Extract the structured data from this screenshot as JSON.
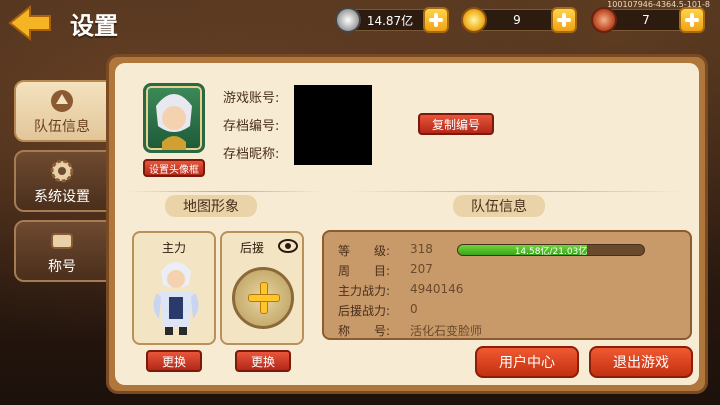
{
  "header": {
    "title": "设置",
    "watermark": "100107946-4364.5-101-8"
  },
  "resources": [
    {
      "name": "silver",
      "icon": "silver-coin-icon",
      "value": "14.87亿"
    },
    {
      "name": "gold",
      "icon": "gold-ingot-icon",
      "value": "9"
    },
    {
      "name": "meat",
      "icon": "meat-icon",
      "value": "7"
    }
  ],
  "tabs": [
    {
      "label": "队伍信息",
      "icon": "team-icon",
      "active": true
    },
    {
      "label": "系统设置",
      "icon": "gear-icon",
      "active": false
    },
    {
      "label": "称号",
      "icon": "scroll-icon",
      "active": false
    }
  ],
  "profile": {
    "set_avatar_label": "设置头像框",
    "account_label": "游戏账号:",
    "save_id_label": "存档编号:",
    "save_nick_label": "存档昵称:",
    "copy_id_label": "复制编号"
  },
  "sections": {
    "map_image": "地图形象",
    "team_info": "队伍信息"
  },
  "cards": {
    "main_title": "主力",
    "backup_title": "后援",
    "replace_label": "更换"
  },
  "team": {
    "level_key": "等　　级:",
    "level_val": "318",
    "exp_text": "14.58亿/21.03亿",
    "exp_ratio": 0.693,
    "week_key": "周　　目:",
    "week_val": "207",
    "main_power_key": "主力战力:",
    "main_power_val": "4940146",
    "backup_power_key": "后援战力:",
    "backup_power_val": "0",
    "title_key": "称　　号:",
    "title_val": "活化石变脸师"
  },
  "buttons": {
    "user_center": "用户中心",
    "exit_game": "退出游戏"
  },
  "colors": {
    "accent_orange": "#f0a316",
    "red_button": "#c2300f",
    "panel": "#f7ecd3",
    "exp_green": "#3aa51a"
  }
}
